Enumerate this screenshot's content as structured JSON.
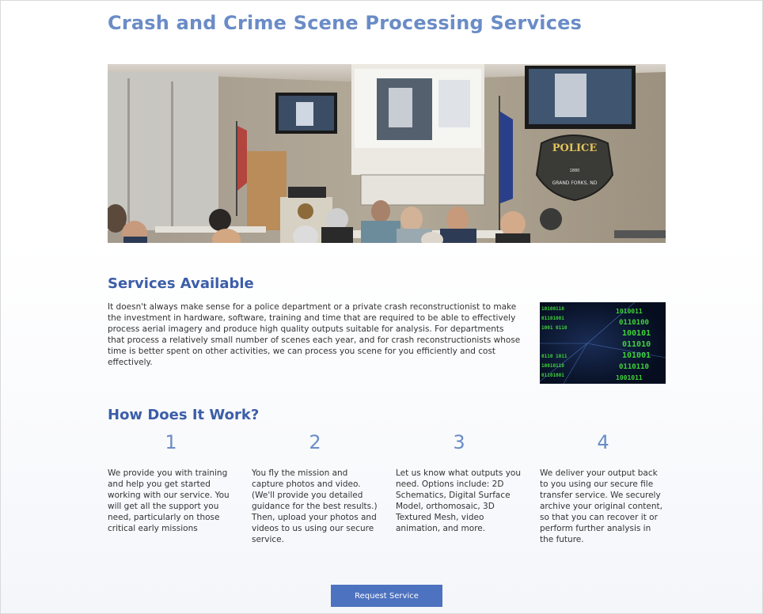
{
  "page": {
    "title": "Crash and Crime Scene Processing Services"
  },
  "hero": {
    "badge_text": "POLICE",
    "badge_year": "1880",
    "badge_city": "GRAND FORKS, ND"
  },
  "services": {
    "heading": "Services Available",
    "body": "It doesn't always make sense for a police department or a private crash reconstructionist to make the investment in hardware, software, training and time that are required to be able to effectively process aerial imagery and produce high quality outputs suitable for analysis.  For departments that process a relatively small number of scenes each year, and for crash reconstructionists whose time is better spent on other activities, we can process you scene for you efficiently and cost effectively."
  },
  "how": {
    "heading": "How Does It Work?",
    "steps": [
      {
        "number": "1",
        "text": "We provide you with training and help you get started working with our service. You will get all the support you need, particularly on those critical early missions"
      },
      {
        "number": "2",
        "text": "You fly the mission and capture photos and video. (We'll provide you detailed guidance for the best results.) Then, upload your photos and videos to us using our secure service."
      },
      {
        "number": "3",
        "text": "Let us know what outputs you need. Options include: 2D Schematics, Digital Surface Model, orthomosaic, 3D Textured Mesh, video animation, and more."
      },
      {
        "number": "4",
        "text": "We deliver your output back to you using our secure file transfer service. We securely archive your original content, so that you can recover it or perform further analysis in the future."
      }
    ]
  },
  "cta": {
    "label": "Request Service"
  }
}
